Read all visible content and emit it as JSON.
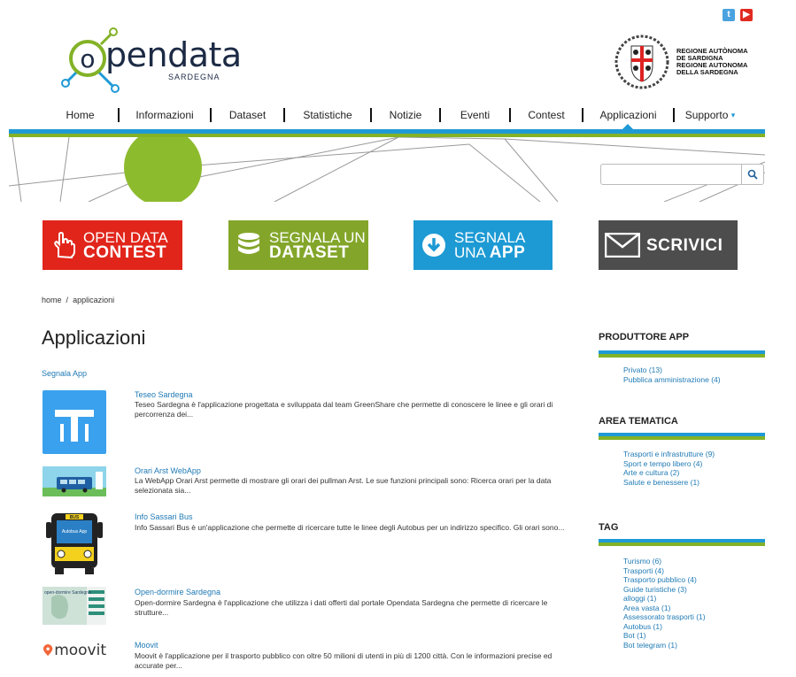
{
  "social": {
    "twitter_label": "t",
    "youtube_label": "▶"
  },
  "logo": {
    "text": "pendata",
    "circle_letter": "o",
    "sub": "SARDEGNA"
  },
  "region": {
    "line1": "REGIONE AUTÒNOMA",
    "line2": "DE SARDIGNA",
    "line3": "REGIONE AUTONOMA",
    "line4": "DELLA SARDEGNA"
  },
  "nav": {
    "items": [
      "Home",
      "Informazioni",
      "Dataset",
      "Statistiche",
      "Notizie",
      "Eventi",
      "Contest",
      "Applicazioni",
      "Supporto"
    ],
    "active": "Applicazioni",
    "support_caret": "▾"
  },
  "search": {
    "placeholder": ""
  },
  "banners": [
    {
      "line1": "OPEN DATA",
      "line2": "CONTEST",
      "color": "#e1251b"
    },
    {
      "line1": "SEGNALA UN",
      "line2": "DATASET",
      "color": "#83a62a"
    },
    {
      "line1": "SEGNALA",
      "line2_pre": "UNA ",
      "line2": "APP",
      "color": "#1d9ad4"
    },
    {
      "line1": "SCRIVICI",
      "color": "#4d4d4d"
    }
  ],
  "breadcrumb": {
    "home": "home",
    "sep": "/",
    "current": "applicazioni"
  },
  "page": {
    "title": "Applicazioni",
    "signal": "Segnala App"
  },
  "apps": [
    {
      "name": "Teseo Sardegna",
      "desc": "Teseo Sardegna è l'applicazione progettata e sviluppata dal team GreenShare che permette di conoscere le linee e gli orari di percorrenza dei..."
    },
    {
      "name": "Orari Arst WebApp",
      "desc": "La WebApp Orari Arst permette di mostrare gli orari dei pullman Arst. Le sue funzioni principali sono: Ricerca orari per la data selezionata sia..."
    },
    {
      "name": "Info Sassari Bus",
      "desc": "Info Sassari Bus è un'applicazione che permette di ricercare tutte le linee degli Autobus per un indirizzo specifico. Gli orari sono..."
    },
    {
      "name": "Open-dormire Sardegna",
      "desc": "Open-dormire Sardegna è l'applicazione che utilizza i dati offerti dal portale Opendata Sardegna che permette di ricercare le strutture..."
    },
    {
      "name": "Moovit",
      "desc": "Moovit è l'applicazione per il trasporto pubblico con oltre 50 milioni di utenti in più di 1200 città. Con le informazioni precise ed accurate per..."
    }
  ],
  "app_thumbs": {
    "bus_label": "BUS",
    "bus_sub": "Autobus App",
    "dormire_label": "open-dormire Sardegna",
    "moovit": "moovit"
  },
  "sidebar": {
    "produttore": {
      "title": "PRODUTTORE APP",
      "items": [
        "Privato (13)",
        "Pubblica amministrazione (4)"
      ]
    },
    "area": {
      "title": "AREA TEMATICA",
      "items": [
        "Trasporti e infrastrutture (9)",
        "Sport e tempo libero (4)",
        "Arte e cultura (2)",
        "Salute e benessere (1)"
      ]
    },
    "tag": {
      "title": "TAG",
      "items": [
        "Turismo (6)",
        "Trasporti (4)",
        "Trasporto pubblico (4)",
        "Guide turistiche (3)",
        "alloggi (1)",
        "Area vasta (1)",
        "Assessorato trasporti (1)",
        "Autobus (1)",
        "Bot (1)",
        "Bot telegram (1)"
      ]
    }
  },
  "colors": {
    "blue": "#1f9ad6",
    "green": "#83b227",
    "link": "#1f7ab5"
  }
}
